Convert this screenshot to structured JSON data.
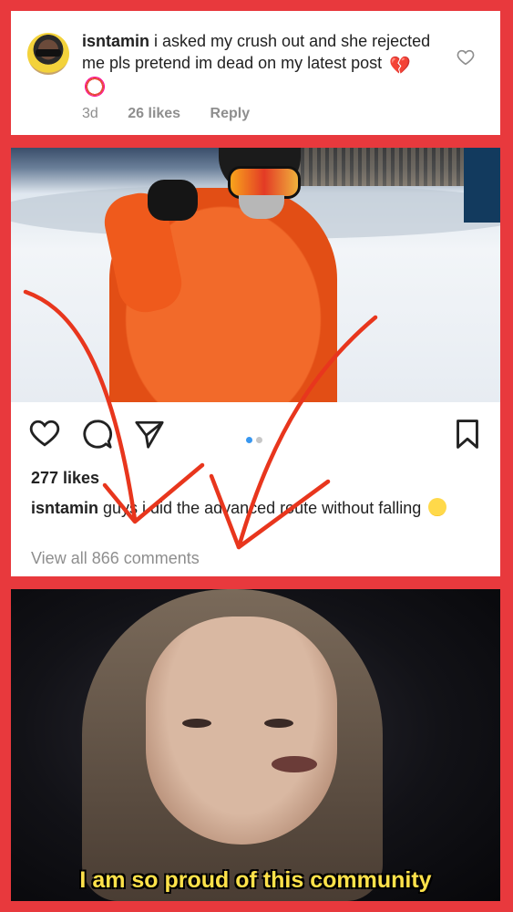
{
  "comment": {
    "username": "isntamin",
    "text": " i asked my crush out and she rejected me pls pretend im dead on my latest post",
    "emojis": [
      "broken-heart-emoji",
      "clown-emoji"
    ],
    "time": "3d",
    "likes": "26 likes",
    "reply_label": "Reply"
  },
  "post": {
    "likes": "277 likes",
    "caption_user": "isntamin",
    "caption_text": " guys i did the advanced route without falling",
    "caption_emoji": "pleading-face-emoji",
    "view_all": "View all 866 comments",
    "carousel": {
      "count": 2,
      "active": 1
    }
  },
  "meme": {
    "caption": "I am so proud of this community"
  },
  "colors": {
    "border": "#e8393d",
    "arrow": "#e8361d",
    "dot_active": "#3897f0",
    "dot_inactive": "#c7c7c7",
    "meta_gray": "#8e8e8e",
    "caption_yellow": "#ffe24a"
  }
}
